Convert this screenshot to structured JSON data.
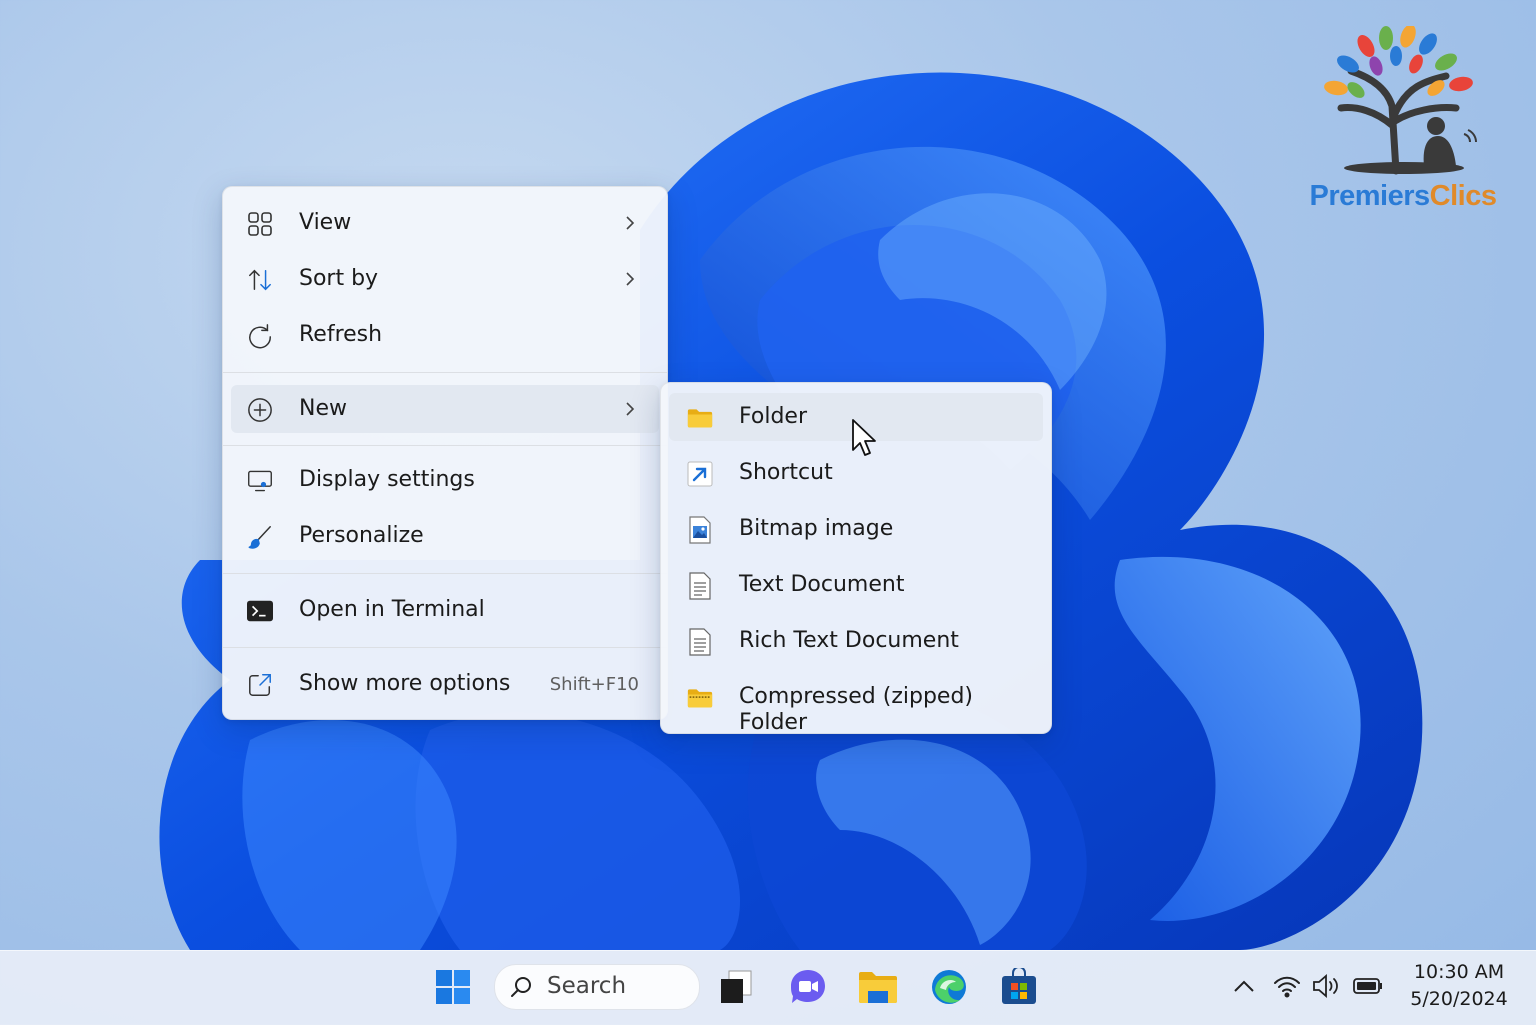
{
  "brand": {
    "name_part1": "Premiers",
    "name_part2": "Clics",
    "color1": "#2a7bd6",
    "color2": "#e08a2a"
  },
  "context_menu": {
    "items": [
      {
        "label": "View",
        "icon": "grid-icon",
        "submenu": true
      },
      {
        "label": "Sort by",
        "icon": "sort-arrows-icon",
        "submenu": true
      },
      {
        "label": "Refresh",
        "icon": "refresh-icon"
      },
      {
        "label": "New",
        "icon": "plus-circle-icon",
        "submenu": true,
        "highlighted": true
      },
      {
        "label": "Display settings",
        "icon": "display-icon"
      },
      {
        "label": "Personalize",
        "icon": "brush-icon"
      },
      {
        "label": "Open in Terminal",
        "icon": "terminal-icon"
      },
      {
        "label": "Show more options",
        "icon": "share-icon",
        "shortcut": "Shift+F10"
      }
    ]
  },
  "new_submenu": {
    "items": [
      {
        "label": "Folder",
        "icon": "folder-icon",
        "highlighted": true
      },
      {
        "label": "Shortcut",
        "icon": "shortcut-arrow-icon"
      },
      {
        "label": "Bitmap image",
        "icon": "image-file-icon"
      },
      {
        "label": "Text Document",
        "icon": "text-document-icon"
      },
      {
        "label": "Rich Text Document",
        "icon": "rich-text-document-icon"
      },
      {
        "label": "Compressed (zipped) Folder",
        "icon": "zip-folder-icon"
      }
    ]
  },
  "taskbar": {
    "search_label": "Search",
    "pinned": [
      "windows-start-icon",
      "task-view-icon",
      "chat-icon",
      "file-explorer-icon",
      "edge-icon",
      "store-icon"
    ],
    "tray": [
      "chevron-up-icon",
      "wifi-icon",
      "volume-icon",
      "battery-icon"
    ],
    "time": "10:30 AM",
    "date": "5/20/2024"
  },
  "colors": {
    "accent": "#0a5ce0",
    "folder": "#f5c518",
    "menu_bg": "#f3f6fb"
  }
}
